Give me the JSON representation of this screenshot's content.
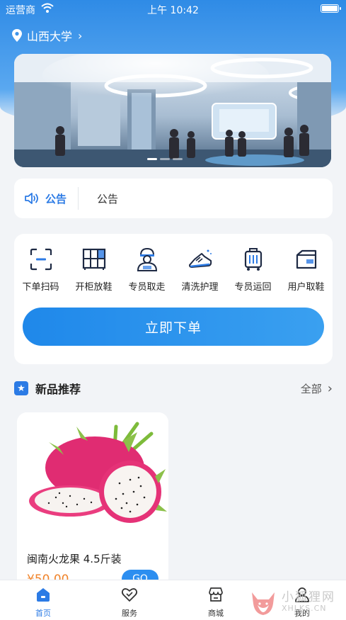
{
  "status_bar": {
    "carrier": "运营商",
    "time": "上午 10:42"
  },
  "location": {
    "name": "山西大学"
  },
  "notice": {
    "title": "公告",
    "text": "公告"
  },
  "services": [
    {
      "label": "下单扫码",
      "icon": "scan-icon"
    },
    {
      "label": "开柜放鞋",
      "icon": "locker-icon"
    },
    {
      "label": "专员取走",
      "icon": "courier-icon"
    },
    {
      "label": "清洗护理",
      "icon": "shoe-clean-icon"
    },
    {
      "label": "专员运回",
      "icon": "luggage-icon"
    },
    {
      "label": "用户取鞋",
      "icon": "box-icon"
    }
  ],
  "order_button": "立即下单",
  "new_products": {
    "title": "新品推荐",
    "more": "全部"
  },
  "product": {
    "name": "闽南火龙果 4.5斤装",
    "price": "¥50.00",
    "action": "GO"
  },
  "tabbar": [
    {
      "label": "首页",
      "icon": "home-icon",
      "active": true
    },
    {
      "label": "服务",
      "icon": "heart-icon",
      "active": false
    },
    {
      "label": "商城",
      "icon": "shop-icon",
      "active": false
    },
    {
      "label": "我的",
      "icon": "user-icon",
      "active": false
    }
  ],
  "watermark": {
    "main": "小狐狸网",
    "sub": "XHLKS.CN"
  },
  "colors": {
    "primary": "#2c7be5",
    "header_gradient_top": "#2f8be6",
    "price": "#f0832a",
    "background": "#f2f4f7"
  }
}
